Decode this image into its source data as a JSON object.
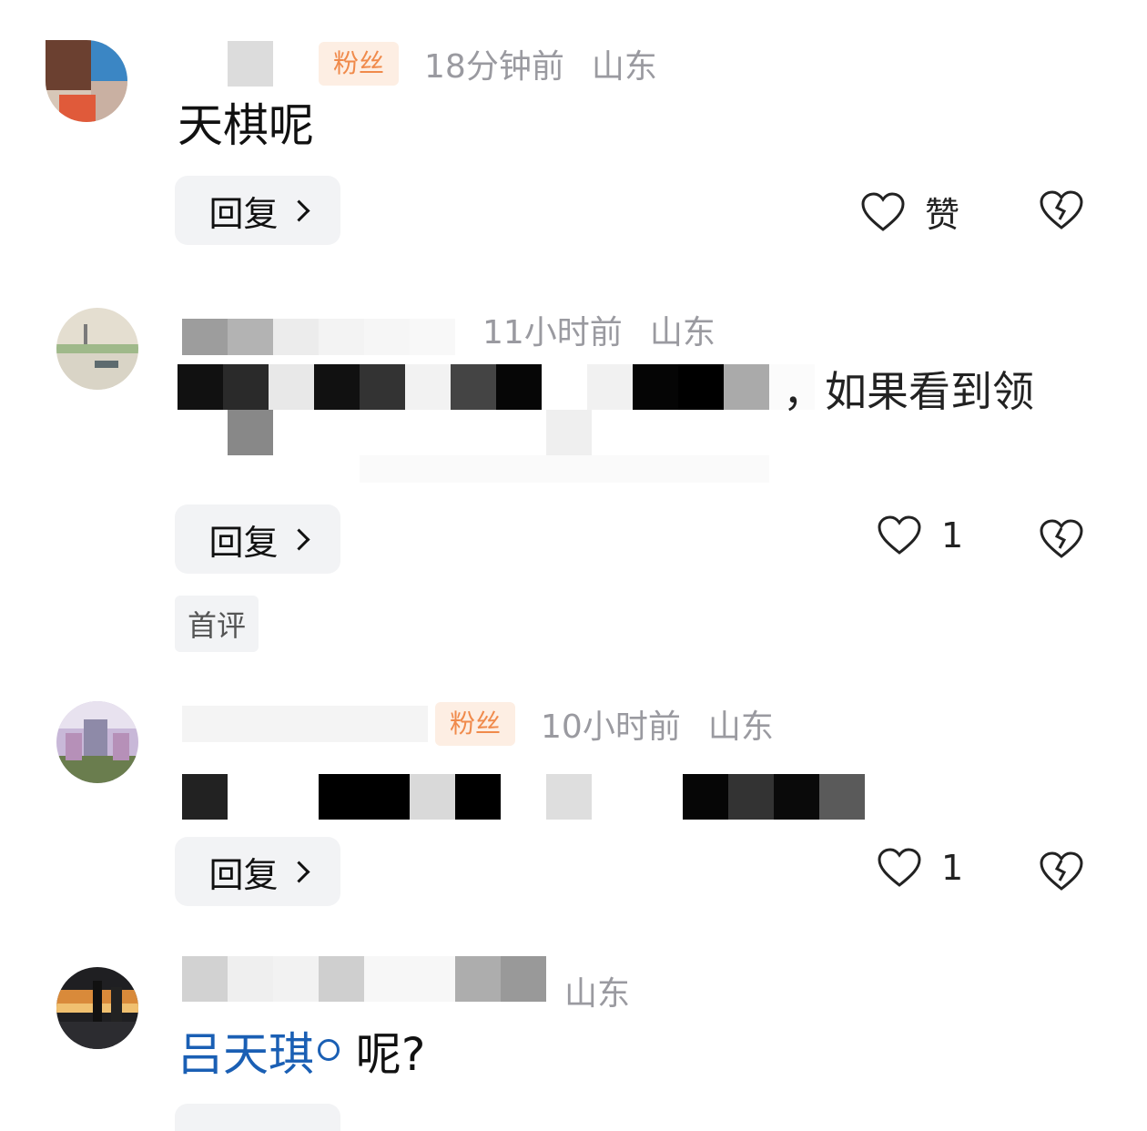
{
  "comments": [
    {
      "badge": "粉丝",
      "time": "18分钟前",
      "location": "山东",
      "text": "天棋呢",
      "reply_label": "回复",
      "like_label": "赞"
    },
    {
      "time": "11小时前",
      "location": "山东",
      "text_visible_end": "，如果看到领",
      "reply_label": "回复",
      "like_count": "1",
      "tag": "首评"
    },
    {
      "badge": "粉丝",
      "time": "10小时前",
      "location": "山东",
      "reply_label": "回复",
      "like_count": "1"
    },
    {
      "location": "山东",
      "mention": "吕天琪",
      "text_after": " 呢?"
    }
  ],
  "colors": {
    "badge_bg": "#fdeee3",
    "badge_text": "#f08a4b",
    "mention": "#1a5fb4",
    "meta_text": "#9a9aa0"
  }
}
